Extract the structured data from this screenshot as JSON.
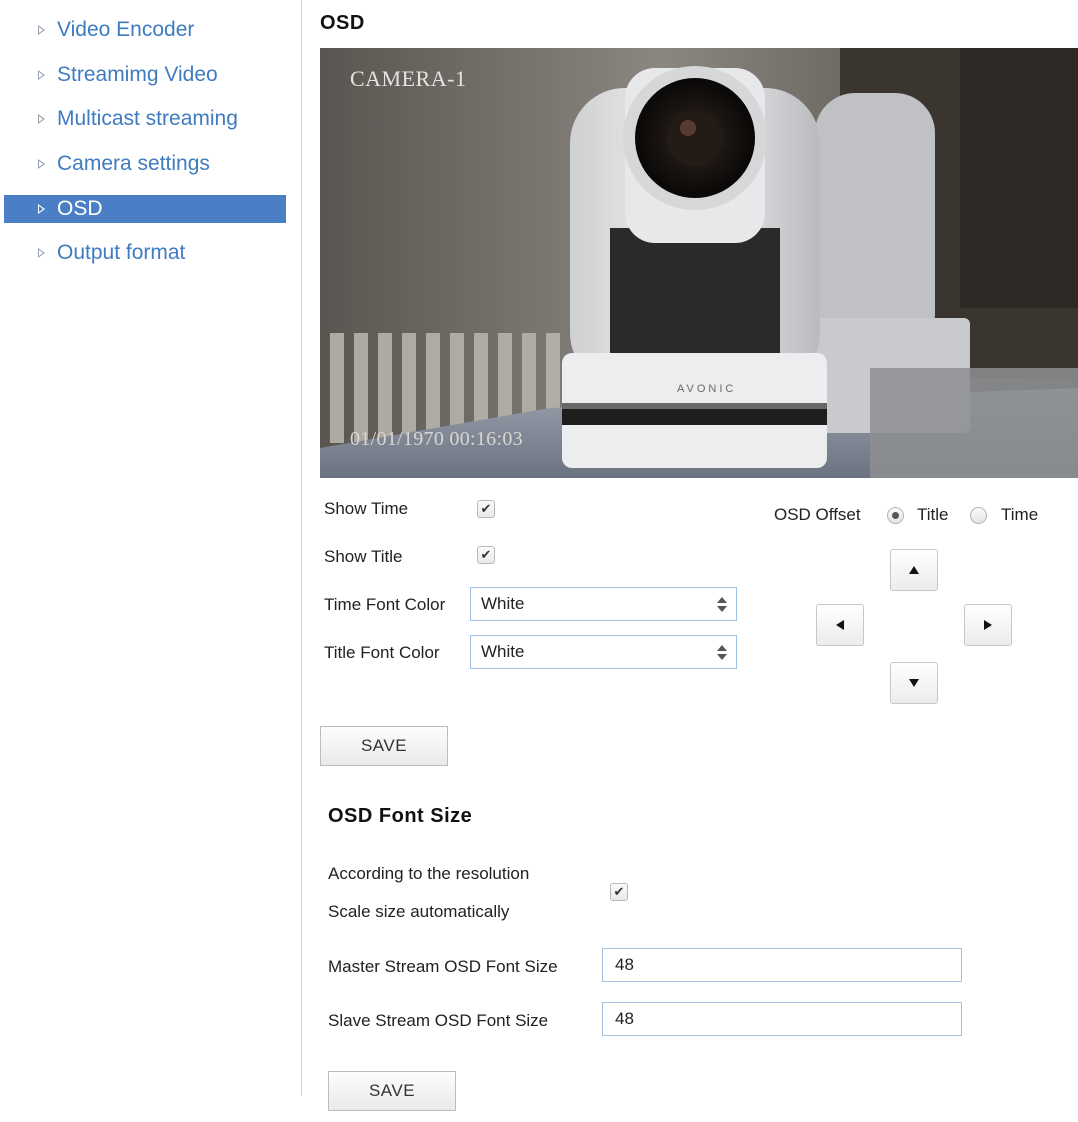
{
  "sidebar": {
    "items": [
      {
        "label": "Video Encoder"
      },
      {
        "label": "Streamimg Video"
      },
      {
        "label": "Multicast streaming"
      },
      {
        "label": "Camera settings"
      },
      {
        "label": "OSD"
      },
      {
        "label": "Output format"
      }
    ],
    "active_index": 4,
    "link_color": "#3f7bc0",
    "active_bg": "#4a7fc6"
  },
  "osd": {
    "title": "OSD",
    "preview": {
      "title_overlay": "CAMERA-1",
      "time_overlay": "01/01/1970 00:16:03",
      "brand_text": "AVONIC"
    },
    "show_time": {
      "label": "Show Time",
      "checked": true
    },
    "show_title": {
      "label": "Show Title",
      "checked": true
    },
    "time_font_color": {
      "label": "Time Font Color",
      "value": "White"
    },
    "title_font_color": {
      "label": "Title Font Color",
      "value": "White"
    },
    "offset": {
      "label": "OSD Offset",
      "options": [
        "Title",
        "Time"
      ],
      "selected": "Title"
    },
    "save_label": "SAVE"
  },
  "font_size": {
    "title": "OSD Font Size",
    "auto_label_line1": "According to the resolution",
    "auto_label_line2": "Scale size automatically",
    "auto_checked": true,
    "master_label": "Master Stream OSD Font Size",
    "master_value": "48",
    "slave_label": "Slave Stream OSD Font Size",
    "slave_value": "48",
    "save_label": "SAVE"
  }
}
